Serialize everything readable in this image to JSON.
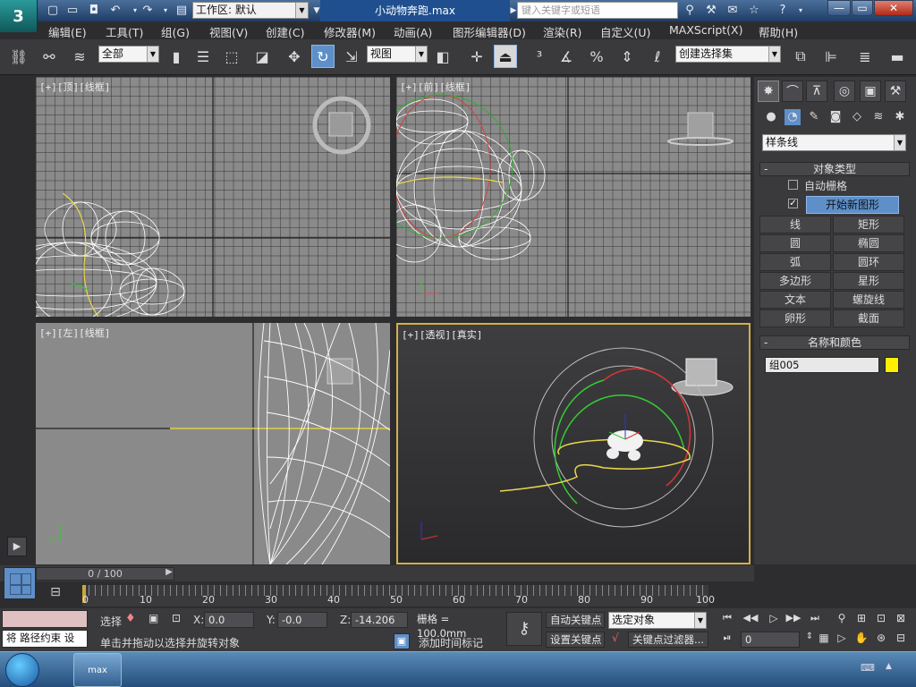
{
  "window": {
    "logo": "3",
    "workspace": "工作区: 默认",
    "doc_title": "小动物奔跑.max",
    "search_placeholder": "键入关键字或短语",
    "min": "—",
    "max": "▭",
    "close": "✕"
  },
  "menu": [
    "编辑(E)",
    "工具(T)",
    "组(G)",
    "视图(V)",
    "创建(C)",
    "修改器(M)",
    "动画(A)",
    "图形编辑器(D)",
    "渲染(R)",
    "自定义(U)",
    "MAXScript(X)",
    "帮助(H)"
  ],
  "toolbar": {
    "selection_filter": "全部",
    "ref_coord": "视图",
    "named_sel": "创建选择集"
  },
  "viewports": {
    "top": {
      "label": "[+][顶][线框]"
    },
    "front": {
      "label": "[+][前][线框]"
    },
    "left": {
      "label": "[+][左][线框]"
    },
    "persp": {
      "label": "[+][透视][真实]"
    }
  },
  "cmdpanel": {
    "category": "样条线",
    "object_type": "对象类型",
    "auto_grid": "自动栅格",
    "start_new_shape": "开始新图形",
    "shapes": [
      "线",
      "矩形",
      "圆",
      "椭圆",
      "弧",
      "圆环",
      "多边形",
      "星形",
      "文本",
      "螺旋线",
      "卵形",
      "截面"
    ],
    "name_color": "名称和颜色",
    "object_name": "组005",
    "object_color": "#ffee00"
  },
  "timeline": {
    "slider": "0 / 100",
    "ticks": [
      "0",
      "10",
      "20",
      "30",
      "40",
      "50",
      "60",
      "70",
      "80",
      "90",
      "100"
    ]
  },
  "status": {
    "script_listener": "",
    "hint_text": "将 路径约束 设",
    "select_label": "选择",
    "x_label": "X:",
    "x_value": "0.0",
    "y_label": "Y:",
    "y_value": "-0.0",
    "z_label": "Z:",
    "z_value": "-14.206",
    "grid": "栅格 = 100.0mm",
    "prompt": "单击并拖动以选择并旋转对象",
    "add_time_tag": "添加时间标记",
    "auto_key": "自动关键点",
    "set_key": "设置关键点",
    "key_mode": "选定对象",
    "key_filters": "关键点过滤器...",
    "frame": "0"
  },
  "taskbar": {
    "app_label": "max"
  }
}
